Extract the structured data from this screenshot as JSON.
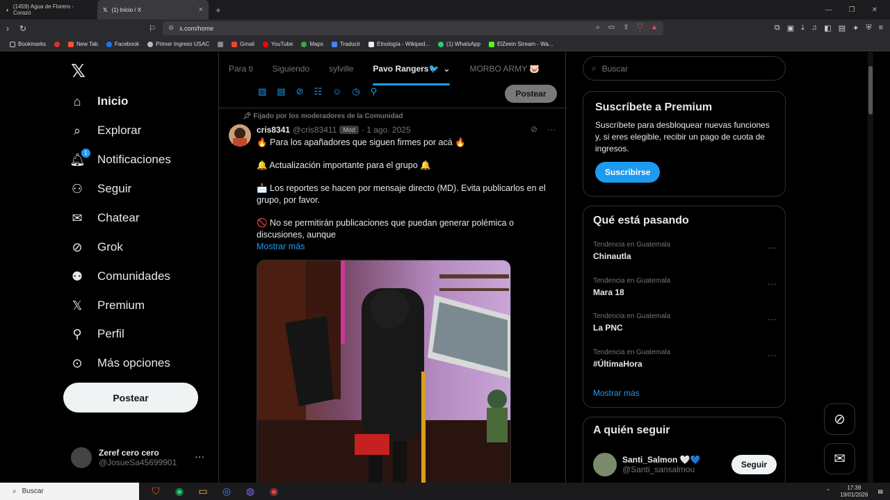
{
  "browser": {
    "tabs": [
      {
        "title": "(1459) Agua de Florero - Corazó",
        "active": false
      },
      {
        "title": "(1) Inicio / X",
        "active": true
      }
    ],
    "url": "x.com/home",
    "bookmarks": [
      "Bookmarks",
      "New Tab",
      "Facebook",
      "Primer Ingreso USAC",
      "Gmail",
      "YouTube",
      "Maps",
      "Traducir",
      "Etnología - Wikiped...",
      "(1) WhatsApp",
      "ElZeein Stream - Wa..."
    ]
  },
  "sidebar": {
    "items": [
      {
        "label": "Inicio",
        "icon": "home-icon"
      },
      {
        "label": "Explorar",
        "icon": "search-icon"
      },
      {
        "label": "Notificaciones",
        "icon": "bell-icon",
        "badge": "1"
      },
      {
        "label": "Seguir",
        "icon": "person-plus-icon"
      },
      {
        "label": "Chatear",
        "icon": "mail-icon"
      },
      {
        "label": "Grok",
        "icon": "grok-icon"
      },
      {
        "label": "Comunidades",
        "icon": "communities-icon"
      },
      {
        "label": "Premium",
        "icon": "x-icon"
      },
      {
        "label": "Perfil",
        "icon": "person-icon"
      },
      {
        "label": "Más opciones",
        "icon": "more-circle-icon"
      }
    ],
    "post_button": "Postear",
    "account": {
      "name": "Zeref cero cero",
      "handle": "@JosueSa45699901"
    }
  },
  "timeline": {
    "tabs": [
      "Para ti",
      "Siguiendo",
      "sylville",
      "Pavo Rangers🐦",
      "MORBO ARMY 🐷"
    ],
    "active_tab": "Pavo Rangers🐦",
    "compose_button": "Postear",
    "pinned_label": "Fijado por los moderadores de la Comunidad",
    "post": {
      "name": "cris8341",
      "handle": "@cris83411",
      "badge": "Mod",
      "date": "· 1 ago. 2025",
      "lines": [
        "🔥 Para los apañadores que siguen firmes por acá 🔥",
        "🔔 Actualización importante para el grupo 🔔",
        "📩 Los reportes se hacen por mensaje directo (MD). Evita publicarlos en el grupo, por favor.",
        "🚫 No se permitirán publicaciones que puedan generar polémica o discusiones, aunque"
      ],
      "show_more": "Mostrar más"
    }
  },
  "right": {
    "search_placeholder": "Buscar",
    "premium": {
      "title": "Suscríbete a Premium",
      "text": "Suscríbete para desbloquear nuevas funciones y, si eres elegible, recibir un pago de cuota de ingresos.",
      "button": "Suscribirse"
    },
    "trends": {
      "title": "Qué está pasando",
      "items": [
        {
          "context": "Tendencia en Guatemala",
          "name": "Chinautla"
        },
        {
          "context": "Tendencia en Guatemala",
          "name": "Mara 18"
        },
        {
          "context": "Tendencia en Guatemala",
          "name": "La PNC"
        },
        {
          "context": "Tendencia en Guatemala",
          "name": "#ÚltimaHora"
        }
      ],
      "show_more": "Mostrar más"
    },
    "follow": {
      "title": "A quién seguir",
      "items": [
        {
          "name": "Santi_Salmon 🤍💙",
          "handle": "@Santi_sansalmou",
          "button": "Seguir"
        }
      ]
    }
  },
  "taskbar": {
    "search": "Buscar",
    "time": "17:39",
    "date": "19/01/2026"
  }
}
